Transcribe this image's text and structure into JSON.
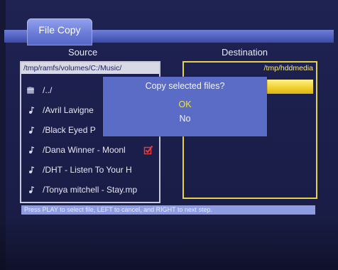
{
  "window": {
    "title": "File Copy"
  },
  "headers": {
    "source": "Source",
    "destination": "Destination"
  },
  "source": {
    "path": "/tmp/ramfs/volumes/C:/Music/",
    "items": [
      {
        "label": "/../",
        "icon": "folder-icon"
      },
      {
        "label": "/Avril Lavigne",
        "icon": "music-note-icon"
      },
      {
        "label": "/Black Eyed P",
        "icon": "music-note-icon"
      },
      {
        "label": "/Dana Winner - Moonl",
        "icon": "music-note-icon",
        "checked": true
      },
      {
        "label": "/DHT - Listen To Your H",
        "icon": "music-note-icon"
      },
      {
        "label": "/Tonya mitchell - Stay.mp",
        "icon": "music-note-icon"
      }
    ]
  },
  "destination": {
    "path": "/tmp/hddmedia"
  },
  "dialog": {
    "title": "Copy selected files?",
    "ok_label": "OK",
    "no_label": "No"
  },
  "status": {
    "text": "Press PLAY to select file, LEFT to cancel, and RIGHT to next step."
  },
  "colors": {
    "accent_yellow": "#f0cf2a",
    "dialog_bg": "#5a6cc6",
    "panel_bg": "#1f2352",
    "status_bar": "#8e9ce2"
  }
}
